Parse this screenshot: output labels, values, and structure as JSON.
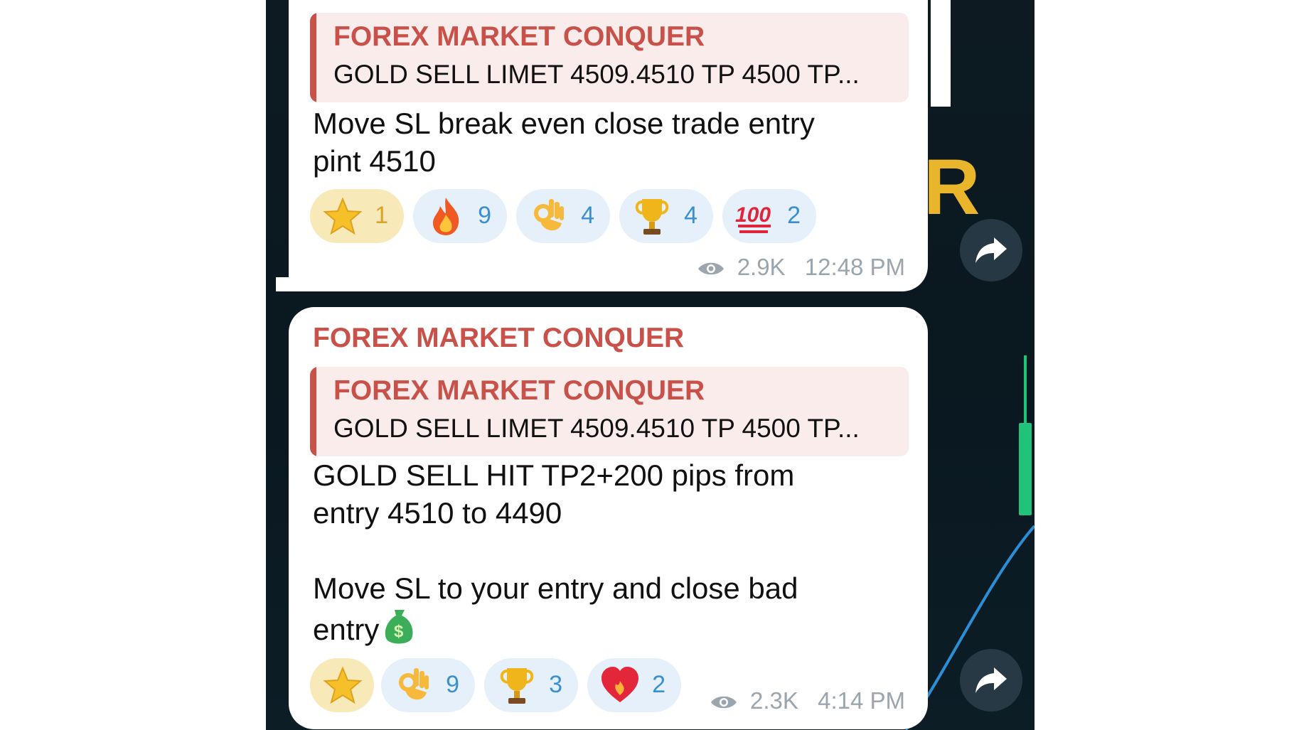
{
  "messages": [
    {
      "sender": "",
      "reply": {
        "name": "FOREX MARKET CONQUER",
        "text": "GOLD SELL LIMET 4509.4510  TP 4500 TP..."
      },
      "text": "Move SL break even close trade entry\npint 4510",
      "reactions": [
        {
          "icon": "star-icon",
          "count": "1",
          "style": "gold"
        },
        {
          "icon": "fire-icon",
          "count": "9"
        },
        {
          "icon": "ok-hand-icon",
          "count": "4"
        },
        {
          "icon": "trophy-icon",
          "count": "4"
        },
        {
          "icon": "hundred-points-icon",
          "count": "2"
        }
      ],
      "views": "2.9K",
      "time": "12:48 PM"
    },
    {
      "sender": "FOREX MARKET CONQUER",
      "reply": {
        "name": "FOREX MARKET CONQUER",
        "text": "GOLD SELL LIMET 4509.4510  TP 4500 TP..."
      },
      "text": "GOLD SELL HIT TP2+200 pips from\nentry 4510 to 4490\n\nMove SL to your entry and close bad\nentry",
      "reactions": [
        {
          "icon": "star-icon",
          "count": "",
          "style": "gold"
        },
        {
          "icon": "ok-hand-icon",
          "count": "9"
        },
        {
          "icon": "trophy-icon",
          "count": "3"
        },
        {
          "icon": "heart-on-fire-icon",
          "count": "2"
        }
      ],
      "views": "2.3K",
      "time": "4:14 PM"
    }
  ],
  "colors": {
    "accent": "#c8524a",
    "reply_bg": "#f9eceb",
    "reaction_bg": "#e5f0fa",
    "count": "#3a8fd1",
    "background": "#0d1a22",
    "candle": "#21c27a"
  }
}
